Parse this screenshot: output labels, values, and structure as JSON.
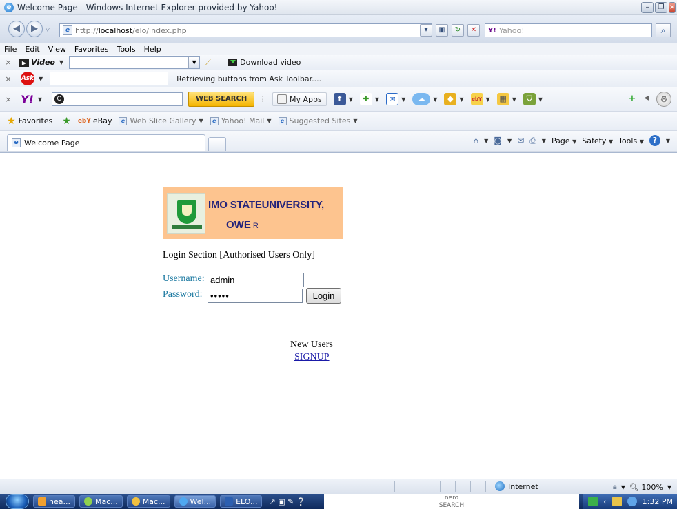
{
  "window": {
    "title": "Welcome Page - Windows Internet Explorer provided by Yahoo!"
  },
  "address": {
    "url_prefix": "http://",
    "url_host": "localhost",
    "url_path": "/elo/index.php",
    "search_placeholder": "Yahoo!"
  },
  "menu": [
    "File",
    "Edit",
    "View",
    "Favorites",
    "Tools",
    "Help"
  ],
  "video_toolbar": {
    "brand": "Video",
    "download_label": "Download video"
  },
  "ask_toolbar": {
    "brand": "Ask",
    "status": "Retrieving buttons from Ask Toolbar...."
  },
  "yahoo_toolbar": {
    "brand": "Y!",
    "search_button": "WEB SEARCH",
    "my_apps": "My Apps"
  },
  "favorites_bar": {
    "favorites_label": "Favorites",
    "items": [
      "eBay",
      "Web Slice Gallery",
      "Yahoo! Mail",
      "Suggested Sites"
    ]
  },
  "tabs": {
    "active_label": "Welcome Page"
  },
  "command_bar": {
    "page": "Page",
    "safety": "Safety",
    "tools": "Tools"
  },
  "page": {
    "banner_line1": "IMO STATEUNIVERSITY,",
    "banner_line2": "OWE",
    "banner_line2_suffix": "R",
    "login_heading": "Login Section [Authorised Users Only]",
    "username_label": "Username:",
    "username_value": "admin",
    "password_label": "Password:",
    "password_value": "•••••",
    "login_button": "Login",
    "new_users": "New Users",
    "signup_link": "SIGNUP"
  },
  "status_bar": {
    "zone": "Internet",
    "zoom": "100%"
  },
  "taskbar": {
    "tasks": [
      "hea...",
      "Mac...",
      "Mac...",
      "Wel...",
      "ELO..."
    ],
    "nero_line1": "nero",
    "nero_line2": "SEARCH",
    "clock": "1:32 PM"
  }
}
